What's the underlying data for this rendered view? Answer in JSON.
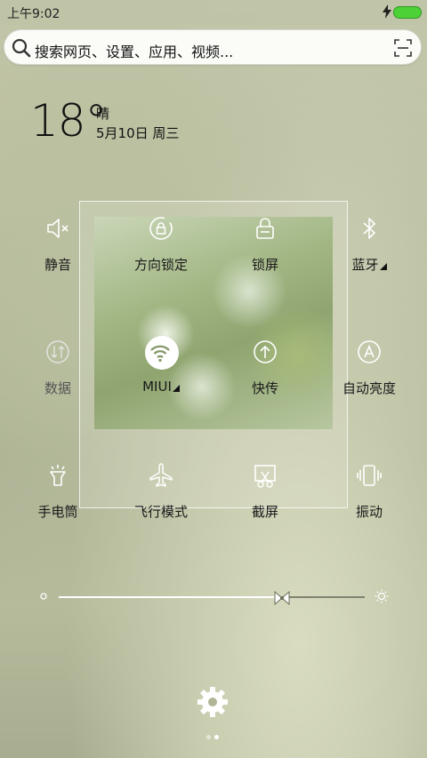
{
  "status_bar": {
    "time": "上午9:02",
    "battery_color": "#4cd137"
  },
  "search": {
    "placeholder": "搜索网页、设置、应用、视频...",
    "left_icon": "search-icon",
    "right_icon": "scan-icon"
  },
  "weather": {
    "temperature": "18°",
    "condition": "晴",
    "date": "5月10日 周三"
  },
  "toggles": [
    {
      "label": "静音",
      "icon": "mute-icon",
      "active": false
    },
    {
      "label": "方向锁定",
      "icon": "rotation-lock-icon",
      "active": false
    },
    {
      "label": "锁屏",
      "icon": "lock-icon",
      "active": false
    },
    {
      "label": "蓝牙",
      "icon": "bluetooth-icon",
      "active": false,
      "has_menu": true
    },
    {
      "label": "数据",
      "icon": "data-icon",
      "active": false,
      "disabled": true
    },
    {
      "label": "MIUI",
      "icon": "wifi-icon",
      "active": true,
      "has_menu": true
    },
    {
      "label": "快传",
      "icon": "transfer-icon",
      "active": false
    },
    {
      "label": "自动亮度",
      "icon": "auto-brightness-icon",
      "active": false
    },
    {
      "label": "手电筒",
      "icon": "flashlight-icon",
      "active": false
    },
    {
      "label": "飞行模式",
      "icon": "airplane-icon",
      "active": false
    },
    {
      "label": "截屏",
      "icon": "screenshot-icon",
      "active": false
    },
    {
      "label": "振动",
      "icon": "vibrate-icon",
      "active": false
    }
  ],
  "brightness": {
    "level": 0.73
  },
  "pager": {
    "pages": 2,
    "current": 2
  },
  "colors": {
    "accent_white": "#ffffff",
    "text": "#1a1a1a",
    "battery": "#4cd137"
  }
}
